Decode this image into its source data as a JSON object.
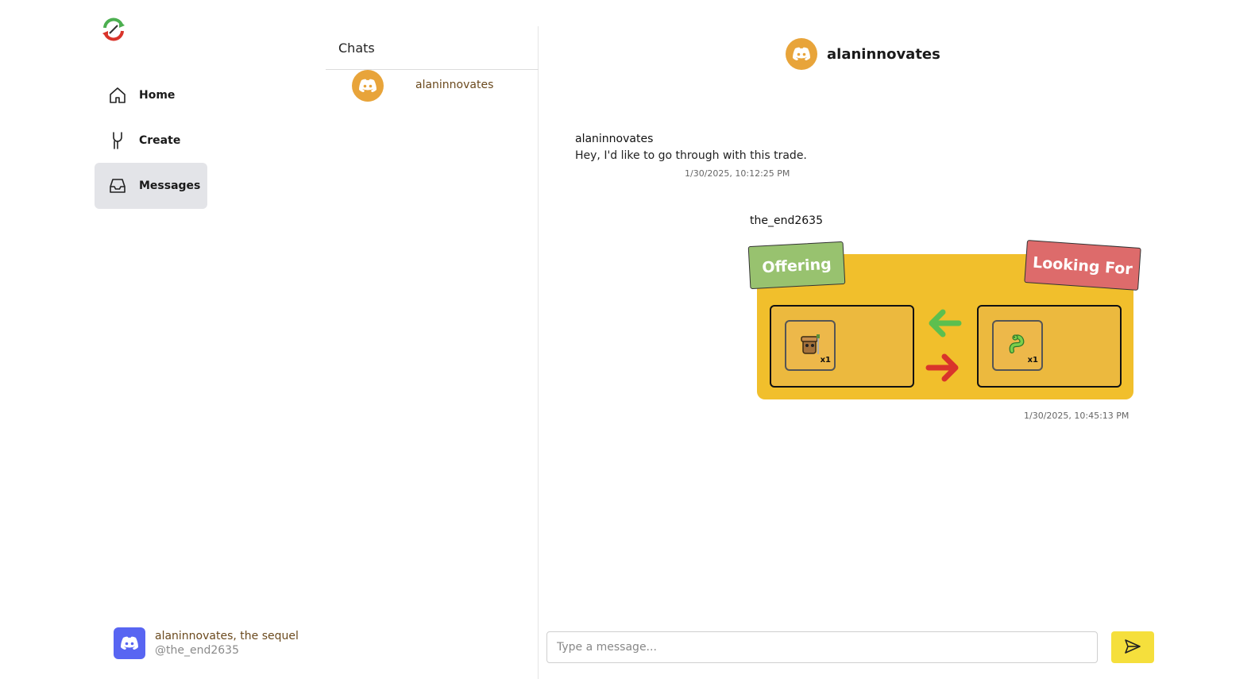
{
  "nav": {
    "items": [
      {
        "label": "Home",
        "icon": "home-icon"
      },
      {
        "label": "Create",
        "icon": "tools-icon"
      },
      {
        "label": "Messages",
        "icon": "inbox-icon"
      }
    ],
    "active": "Messages"
  },
  "profile": {
    "name": "alaninnovates, the sequel",
    "handle": "@the_end2635",
    "icon": "discord-icon"
  },
  "chats": {
    "title": "Chats",
    "items": [
      {
        "name": "alaninnovates",
        "icon": "discord-icon"
      }
    ]
  },
  "conversation": {
    "title": "alaninnovates",
    "messages": [
      {
        "author": "alaninnovates",
        "text": "Hey, I'd like to go through with this trade.",
        "time": "1/30/2025, 10:12:25 PM"
      },
      {
        "author": "the_end2635",
        "trade": {
          "offering_label": "Offering",
          "looking_label": "Looking For",
          "offering_items": [
            {
              "icon": "hat-item-icon",
              "qty": "x1"
            }
          ],
          "looking_items": [
            {
              "icon": "snake-item-icon",
              "qty": "x1"
            }
          ]
        },
        "time": "1/30/2025, 10:45:13 PM"
      }
    ],
    "composer_placeholder": "Type a message...",
    "send_icon": "send-icon"
  },
  "colors": {
    "discord_orange": "#e8a43a",
    "discord_blurple": "#5865f2",
    "trade_bg": "#f1bf2c",
    "offering_tag": "#98c26f",
    "looking_tag": "#dd6b6b",
    "send_button": "#f5df3c",
    "active_nav": "#e3e4e8"
  }
}
